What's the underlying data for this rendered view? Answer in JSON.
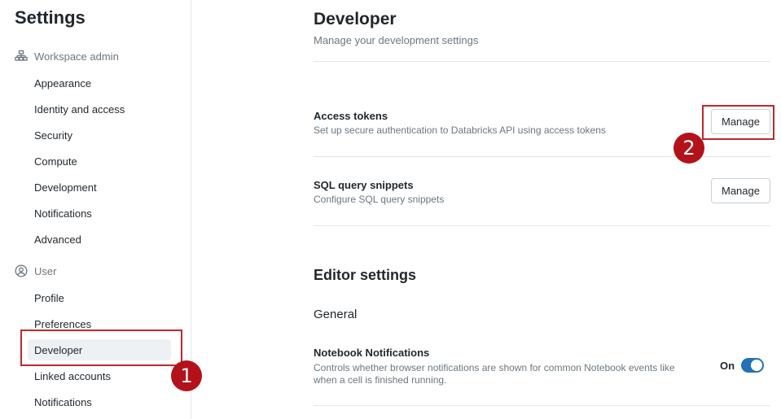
{
  "sidebar": {
    "title": "Settings",
    "workspace_admin": {
      "label": "Workspace admin",
      "icon": "org-chart-icon",
      "items": [
        "Appearance",
        "Identity and access",
        "Security",
        "Compute",
        "Development",
        "Notifications",
        "Advanced"
      ]
    },
    "user": {
      "label": "User",
      "icon": "user-circle-icon",
      "items": [
        "Profile",
        "Preferences",
        "Developer",
        "Linked accounts",
        "Notifications"
      ],
      "active_item": "Developer"
    }
  },
  "main": {
    "title": "Developer",
    "subtitle": "Manage your development settings",
    "access_tokens": {
      "title": "Access tokens",
      "description": "Set up secure authentication to Databricks API using access tokens",
      "button": "Manage"
    },
    "sql_snippets": {
      "title": "SQL query snippets",
      "description": "Configure SQL query snippets",
      "button": "Manage"
    },
    "editor_settings": {
      "title": "Editor settings",
      "general": "General",
      "notebook_notifications": {
        "title": "Notebook Notifications",
        "description_line1": "Controls whether browser notifications are shown for common Notebook events like",
        "description_line2": "when a cell is finished running.",
        "toggle_label": "On",
        "enabled": true
      }
    }
  },
  "annotations": {
    "step1": "1",
    "step2": "2",
    "color": "#c0272d"
  },
  "colors": {
    "accent": "#2272b4",
    "annotation": "#b3121a"
  }
}
